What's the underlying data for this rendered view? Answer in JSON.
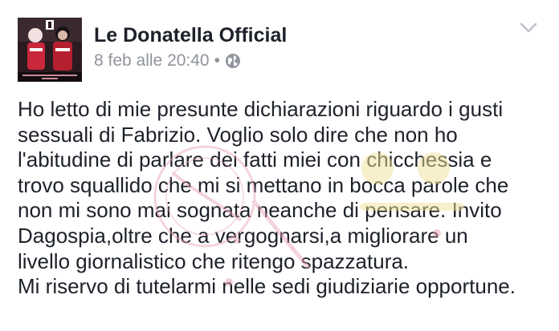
{
  "post": {
    "author": "Le Donatella Official",
    "timestamp": "8 feb alle 20:40",
    "separator": "•",
    "audience_icon": "globe-icon",
    "menu_icon": "chevron-down-icon",
    "lines": [
      "Ho letto di mie presunte dichiarazioni riguardo i gusti",
      "sessuali di Fabrizio. Voglio solo dire che non ho",
      "l'abitudine di parlare dei fatti miei con chicchessia e",
      "trovo squallido che mi si mettano in bocca parole che",
      "non mi sono mai sognata neanche di pensare. Invito",
      "Dagospia,oltre che a vergognarsi,a migliorare un",
      "livello giornalistico che ritengo spazzatura.",
      "Mi riservo di tutelarmi nelle sedi giudiziarie opportune."
    ]
  },
  "colors": {
    "author_text": "#1d2129",
    "meta_text": "#90949c",
    "body_text": "#1d2129",
    "watermark_pink": "#e8a0b4",
    "watermark_yellow": "#f3e39a"
  }
}
